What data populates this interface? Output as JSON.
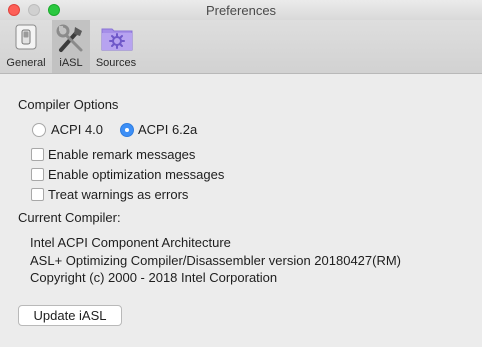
{
  "window": {
    "title": "Preferences"
  },
  "toolbar": {
    "tabs": [
      {
        "label": "General",
        "icon": "switch-icon"
      },
      {
        "label": "iASL",
        "icon": "tools-icon",
        "selected": true
      },
      {
        "label": "Sources",
        "icon": "folder-gear-icon"
      }
    ]
  },
  "compiler_options": {
    "heading": "Compiler Options",
    "acpi_versions": [
      {
        "label": "ACPI 4.0",
        "selected": false
      },
      {
        "label": "ACPI 6.2a",
        "selected": true
      }
    ],
    "checkboxes": [
      {
        "label": "Enable remark messages",
        "checked": false
      },
      {
        "label": "Enable optimization messages",
        "checked": false
      },
      {
        "label": "Treat warnings as errors",
        "checked": false
      }
    ]
  },
  "current_compiler": {
    "heading": "Current Compiler:",
    "lines": [
      "Intel ACPI Component Architecture",
      "ASL+ Optimizing Compiler/Disassembler version 20180427(RM)",
      "Copyright (c) 2000 - 2018 Intel Corporation"
    ]
  },
  "update_button": {
    "label": "Update iASL"
  },
  "colors": {
    "accent": "#3d8ff6",
    "background": "#ececec",
    "close": "#fd5f57",
    "zoom": "#2bc840"
  }
}
